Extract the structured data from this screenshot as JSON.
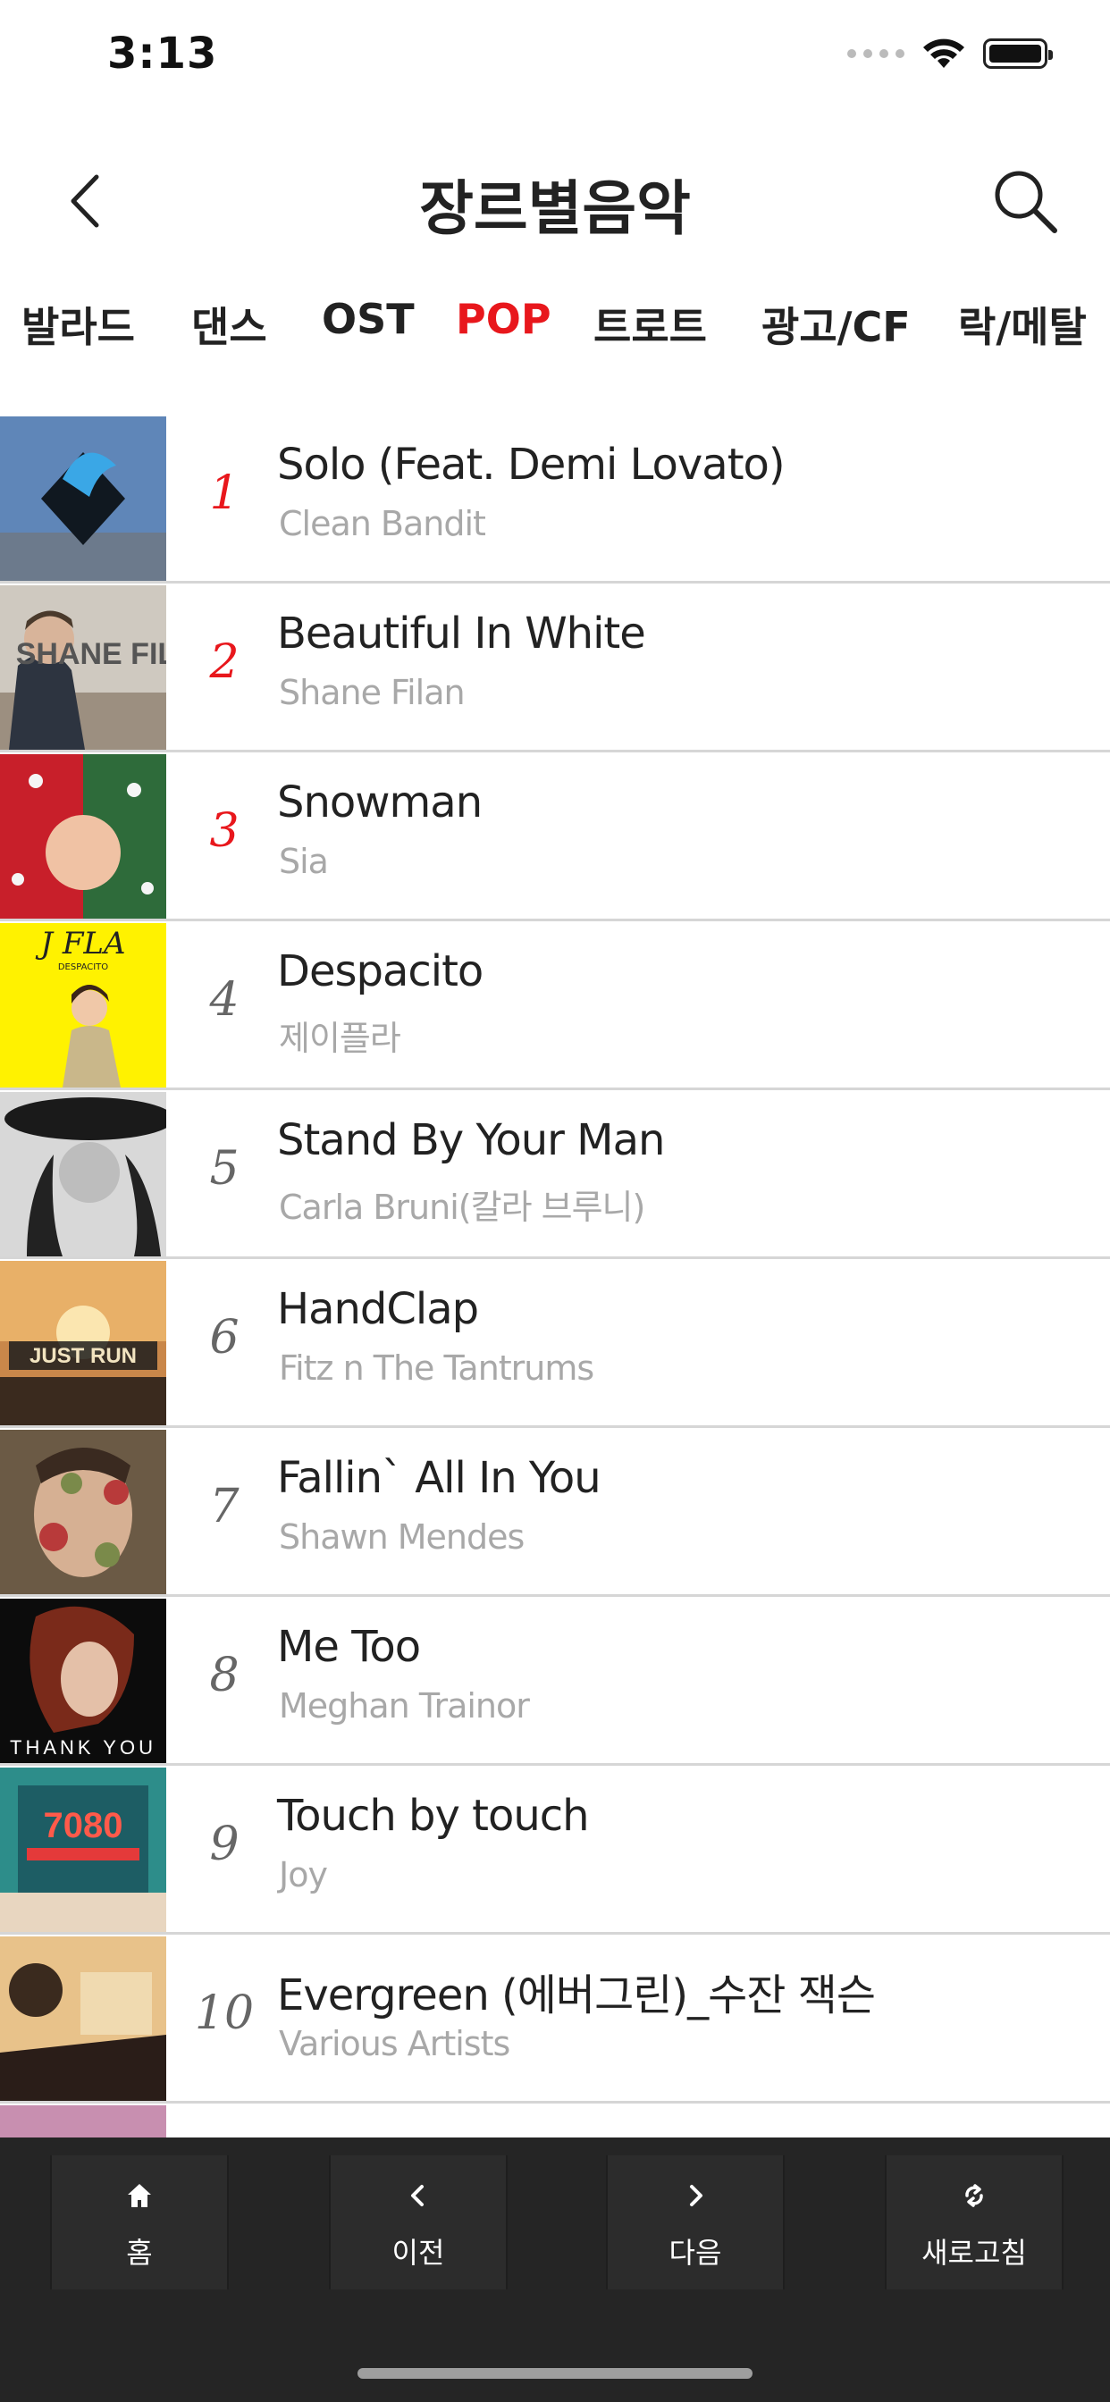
{
  "status": {
    "time": "3:13"
  },
  "header": {
    "title": "장르별음악",
    "back_icon": "chevron-left-icon",
    "search_icon": "search-icon"
  },
  "tabs": [
    {
      "label": "발라드",
      "active": false
    },
    {
      "label": "댄스",
      "active": false
    },
    {
      "label": "OST",
      "active": false
    },
    {
      "label": "POP",
      "active": true
    },
    {
      "label": "트로트",
      "active": false
    },
    {
      "label": "광고/CF",
      "active": false
    },
    {
      "label": "락/메탈",
      "active": false
    }
  ],
  "songs": [
    {
      "rank": "1",
      "title": "Solo (Feat. Demi Lovato)",
      "artist": "Clean Bandit"
    },
    {
      "rank": "2",
      "title": "Beautiful In White",
      "artist": "Shane Filan"
    },
    {
      "rank": "3",
      "title": "Snowman",
      "artist": "Sia"
    },
    {
      "rank": "4",
      "title": "Despacito",
      "artist": "제이플라"
    },
    {
      "rank": "5",
      "title": "Stand By Your Man",
      "artist": "Carla Bruni(칼라 브루니)"
    },
    {
      "rank": "6",
      "title": "HandClap",
      "artist": "Fitz n The Tantrums"
    },
    {
      "rank": "7",
      "title": "Fallin` All In You",
      "artist": "Shawn Mendes"
    },
    {
      "rank": "8",
      "title": "Me Too",
      "artist": "Meghan Trainor"
    },
    {
      "rank": "9",
      "title": "Touch by touch",
      "artist": "Joy"
    },
    {
      "rank": "10",
      "title": "Evergreen (에버그린)_수잔 잭슨",
      "artist": "Various Artists"
    }
  ],
  "album_art_text": {
    "shane": "SHANE FILAN",
    "jfla": "J FLA",
    "jfla_sub": "DESPACITO",
    "justrun": "JUST RUN",
    "thankyou": "THANK YOU",
    "num7080": "7080"
  },
  "bottom_nav": [
    {
      "label": "홈",
      "icon": "home-icon"
    },
    {
      "label": "이전",
      "icon": "chevron-left-icon"
    },
    {
      "label": "다음",
      "icon": "chevron-right-icon"
    },
    {
      "label": "새로고침",
      "icon": "refresh-icon"
    }
  ],
  "colors": {
    "accent": "#e8171c",
    "bottom_bar": "#252525"
  }
}
